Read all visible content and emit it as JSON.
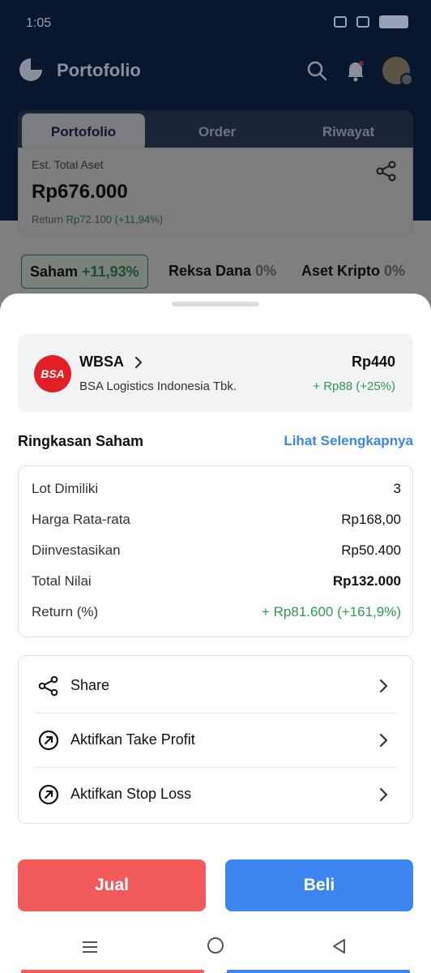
{
  "status_bar": {
    "time": "1:05"
  },
  "header": {
    "title": "Portofolio",
    "tabs": [
      {
        "label": "Portofolio",
        "active": true
      },
      {
        "label": "Order",
        "active": false
      },
      {
        "label": "Riwayat",
        "active": false
      }
    ]
  },
  "portfolio_summary": {
    "label": "Est. Total Aset",
    "value": "Rp676.000",
    "return_label": "Return",
    "return_value": "Rp72.100 (+11,94%)"
  },
  "asset_tabs": [
    {
      "label": "Saham",
      "pct": "+11,93%",
      "active": true
    },
    {
      "label": "Reksa Dana",
      "pct": "0%",
      "active": false
    },
    {
      "label": "Aset Kripto",
      "pct": "0%",
      "active": false
    }
  ],
  "stock": {
    "logo_text": "BSA",
    "code": "WBSA",
    "name": "BSA Logistics Indonesia Tbk.",
    "price": "Rp440",
    "change": "+ Rp88 (+25%)"
  },
  "summary_section": {
    "title": "Ringkasan Saham",
    "link": "Lihat Selengkapnya",
    "rows": [
      {
        "label": "Lot Dimiliki",
        "value": "3"
      },
      {
        "label": "Harga Rata-rata",
        "value": "Rp168,00"
      },
      {
        "label": "Diinvestasikan",
        "value": "Rp50.400"
      },
      {
        "label": "Total Nilai",
        "value": "Rp132.000"
      },
      {
        "label": "Return (%)",
        "value": "+ Rp81.600 (+161,9%)"
      }
    ]
  },
  "actions": [
    {
      "label": "Share",
      "icon": "share-icon"
    },
    {
      "label": "Aktifkan Take Profit",
      "icon": "arrow-up-right-circle-icon"
    },
    {
      "label": "Aktifkan Stop Loss",
      "icon": "arrow-up-right-circle-icon"
    }
  ],
  "buttons": {
    "sell": "Jual",
    "buy": "Beli"
  },
  "colors": {
    "sell": "#f35a5a",
    "buy": "#3d86f2",
    "positive": "#2e9a51",
    "link": "#3d86e6",
    "header_bg": "#08162e"
  }
}
